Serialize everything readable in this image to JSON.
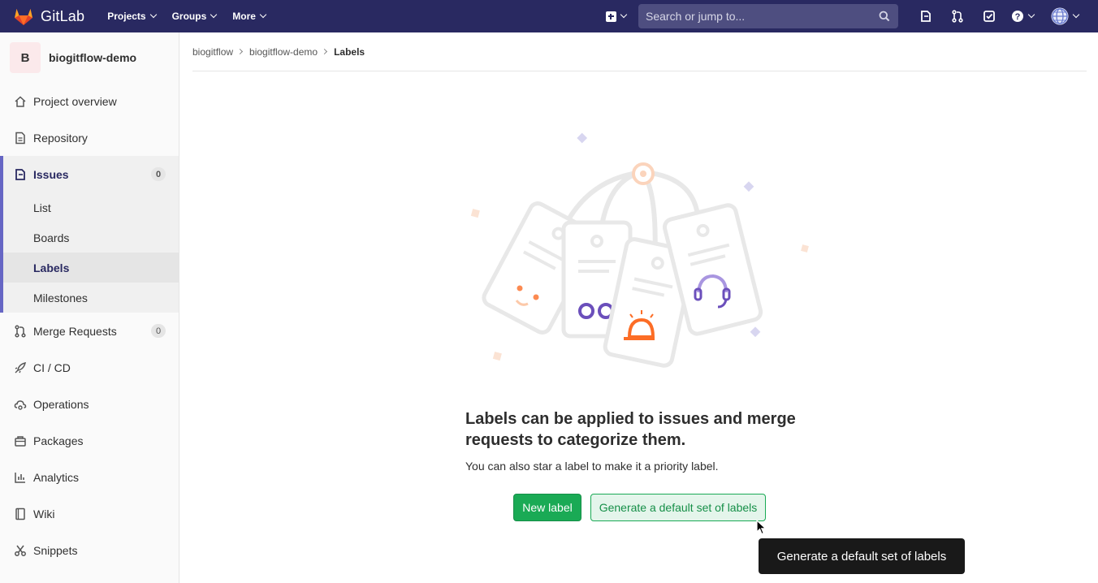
{
  "navbar": {
    "brand": "GitLab",
    "menu": [
      "Projects",
      "Groups",
      "More"
    ],
    "search_placeholder": "Search or jump to...",
    "icons": [
      "plus-square-icon",
      "search-icon",
      "issues-icon",
      "merge-request-icon",
      "todo-icon",
      "help-icon",
      "avatar"
    ]
  },
  "sidebar": {
    "project_initial": "B",
    "project_name": "biogitflow-demo",
    "items": [
      {
        "label": "Project overview",
        "icon": "home-icon"
      },
      {
        "label": "Repository",
        "icon": "doc-icon"
      },
      {
        "label": "Issues",
        "icon": "issues-icon",
        "badge": "0"
      },
      {
        "label": "Merge Requests",
        "icon": "merge-request-icon",
        "badge": "0"
      },
      {
        "label": "CI / CD",
        "icon": "rocket-icon"
      },
      {
        "label": "Operations",
        "icon": "cloud-gear-icon"
      },
      {
        "label": "Packages",
        "icon": "package-icon"
      },
      {
        "label": "Analytics",
        "icon": "chart-icon"
      },
      {
        "label": "Wiki",
        "icon": "book-icon"
      },
      {
        "label": "Snippets",
        "icon": "scissors-icon"
      }
    ],
    "issues_sub": [
      "List",
      "Boards",
      "Labels",
      "Milestones"
    ]
  },
  "breadcrumb": [
    "biogitflow",
    "biogitflow-demo",
    "Labels"
  ],
  "empty_state": {
    "title": "Labels can be applied to issues and merge requests to categorize them.",
    "description": "You can also star a label to make it a priority label.",
    "new_label": "New label",
    "generate": "Generate a default set of labels"
  },
  "tooltip": "Generate a default set of labels",
  "colors": {
    "navbar": "#292961",
    "accent": "#6666c4",
    "success": "#1aaa55"
  }
}
